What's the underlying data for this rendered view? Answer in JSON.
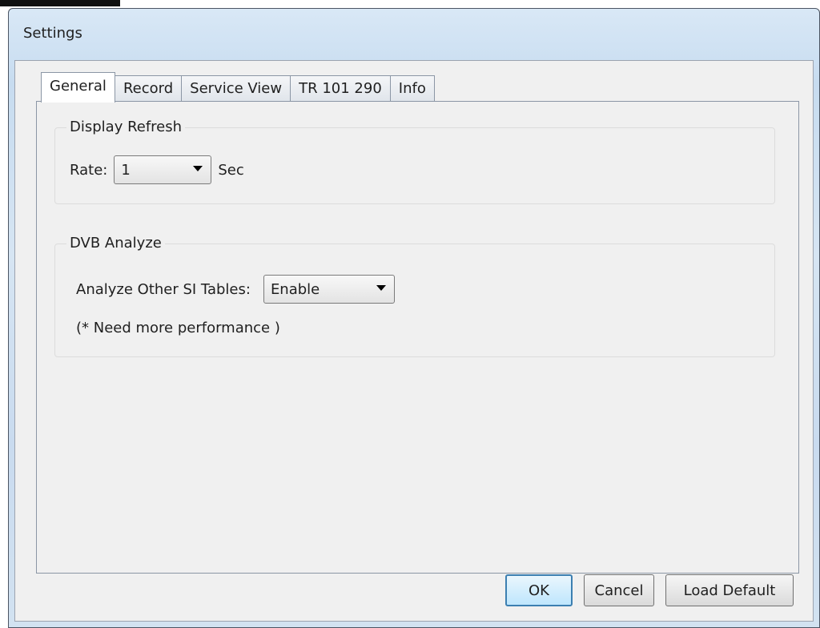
{
  "window": {
    "title": "Settings"
  },
  "tabs": [
    {
      "label": "General",
      "active": true
    },
    {
      "label": "Record",
      "active": false
    },
    {
      "label": "Service View",
      "active": false
    },
    {
      "label": "TR 101 290",
      "active": false
    },
    {
      "label": "Info",
      "active": false
    }
  ],
  "display_refresh": {
    "title": "Display Refresh",
    "rate_label": "Rate:",
    "rate_value": "1",
    "unit_label": "Sec"
  },
  "dvb_analyze": {
    "title": "DVB Analyze",
    "analyze_label": "Analyze Other SI Tables:",
    "analyze_value": "Enable",
    "note": "(* Need more performance )"
  },
  "buttons": {
    "ok": "OK",
    "cancel": "Cancel",
    "load_default": "Load Default"
  },
  "colors": {
    "title_bar": "#c7dcf0",
    "ok_border": "#3c7fb1",
    "panel_background": "#f0f0f0"
  }
}
